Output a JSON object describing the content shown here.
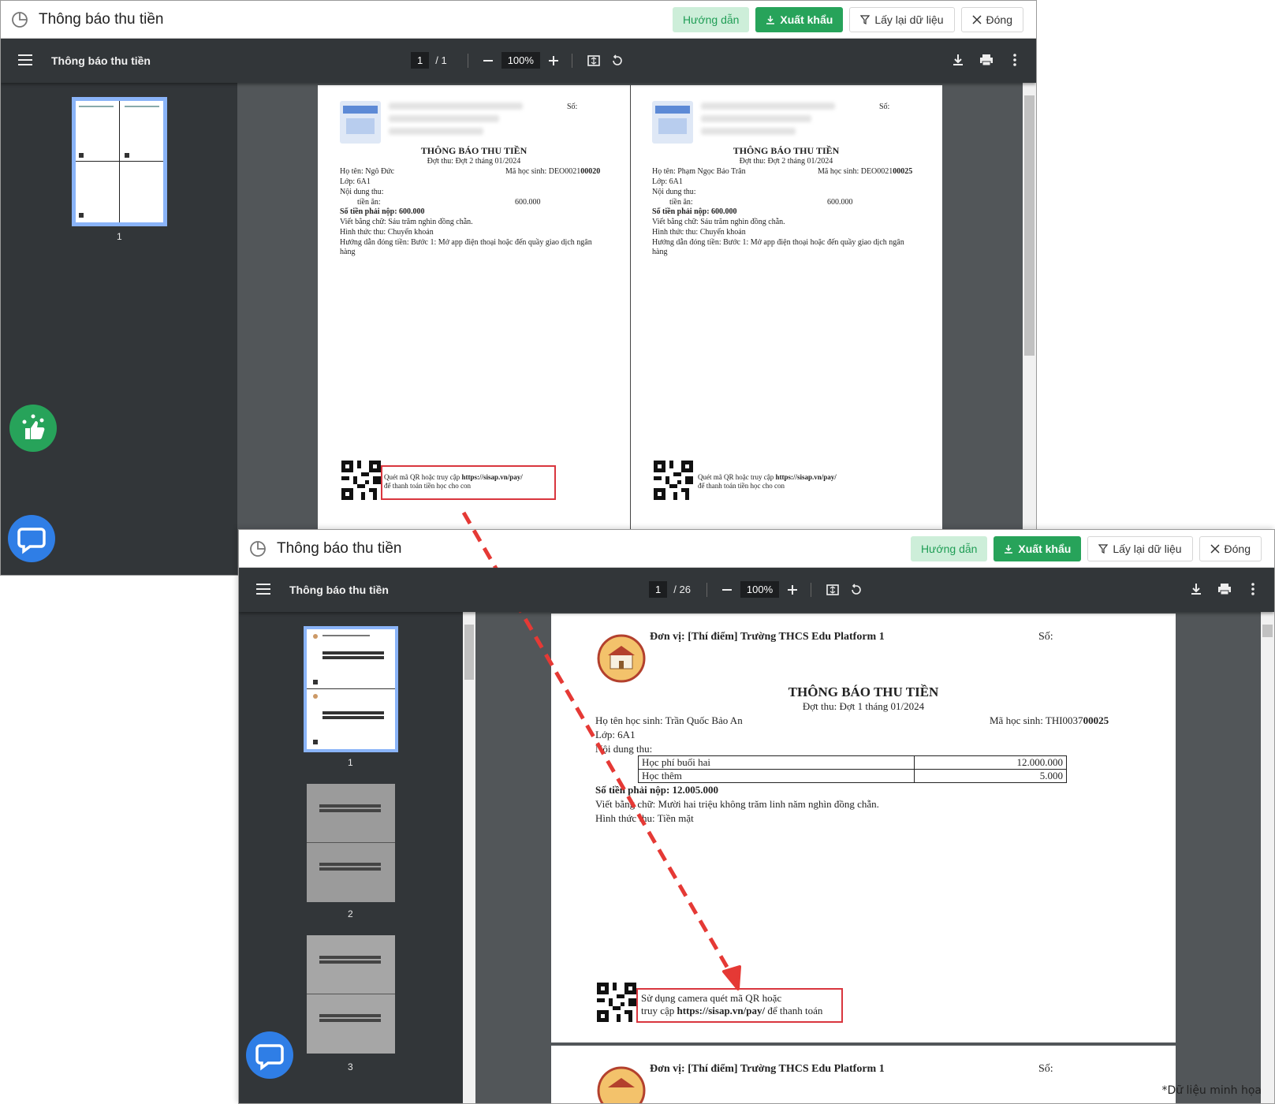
{
  "window1": {
    "title": "Thông báo thu tiền",
    "buttons": {
      "guide": "Hướng dẫn",
      "export": "Xuất khẩu",
      "reload": "Lấy lại dữ liệu",
      "close": "Đóng"
    },
    "pdf_toolbar": {
      "title": "Thông báo thu tiền",
      "current_page": "1",
      "total_pages": "/ 1",
      "zoom": "100%"
    },
    "thumbnail_label": "1",
    "receipts": [
      {
        "so_label": "Số:",
        "heading": "THÔNG BÁO THU TIỀN",
        "period": "Đợt thu: Đợt 2 tháng 01/2024",
        "name": "Họ tên: Ngô Đức",
        "code_prefix": "Mã học sinh: DEO0021",
        "code_suffix": "00020",
        "class": "Lớp: 6A1",
        "content_label": "Nội dung thu:",
        "item_label": "tiền ăn:",
        "item_value": "600.000",
        "amount_label": "Số tiền phải nộp: 600.000",
        "in_words": "Viết bằng chữ: Sáu trăm nghìn đồng chẵn.",
        "method": "Hình thức thu: Chuyển khoản",
        "guide_line1": "Hướng dẫn đóng tiền: Bước 1: Mở app điện thoại hoặc đến quầy giao dịch ngân",
        "guide_line2": "hàng",
        "qr_line1_prefix": "Quét mã QR hoặc truy cập ",
        "qr_link": "https://sisap.vn/pay/",
        "qr_line2": "để thanh toán tiền học cho con"
      },
      {
        "so_label": "Số:",
        "heading": "THÔNG BÁO THU TIỀN",
        "period": "Đợt thu: Đợt 2 tháng 01/2024",
        "name": "Họ tên: Phạm Ngọc Bảo Trân",
        "code_prefix": "Mã học sinh: DEO0021",
        "code_suffix": "00025",
        "class": "Lớp: 6A1",
        "content_label": "Nội dung thu:",
        "item_label": "tiền ăn:",
        "item_value": "600.000",
        "amount_label": "Số tiền phải nộp: 600.000",
        "in_words": "Viết bằng chữ: Sáu trăm nghìn đồng chẵn.",
        "method": "Hình thức thu: Chuyển khoản",
        "guide_line1": "Hướng dẫn đóng tiền: Bước 1: Mở app điện thoại hoặc đến quầy giao dịch ngân",
        "guide_line2": "hàng",
        "qr_line1_prefix": "Quét mã QR hoặc truy cập ",
        "qr_link": "https://sisap.vn/pay/",
        "qr_line2": "để thanh toán tiền học cho con"
      }
    ]
  },
  "window2": {
    "title": "Thông báo thu tiền",
    "buttons": {
      "guide": "Hướng dẫn",
      "export": "Xuất khẩu",
      "reload": "Lấy lại dữ liệu",
      "close": "Đóng"
    },
    "pdf_toolbar": {
      "title": "Thông báo thu tiền",
      "current_page": "1",
      "total_pages": "/ 26",
      "zoom": "100%"
    },
    "thumbnail_labels": [
      "1",
      "2",
      "3"
    ],
    "receipt": {
      "unit": "Đơn vị: [Thí điểm] Trường THCS Edu Platform 1",
      "so_label": "Số:",
      "heading": "THÔNG BÁO THU TIỀN",
      "period": "Đợt thu: Đợt 1 tháng 01/2024",
      "name": "Họ tên học sinh: Trần Quốc Bảo An",
      "code_prefix": "Mã học sinh: THI0037",
      "code_suffix": "00025",
      "class": "Lớp: 6A1",
      "content_label": "Nội dung thu:",
      "items": [
        {
          "name": "Học phí buổi hai",
          "amount": "12.000.000"
        },
        {
          "name": "Học thêm",
          "amount": "5.000"
        }
      ],
      "amount_label": "Số tiền phải nộp: 12.005.000",
      "in_words": "Viết bằng chữ: Mười hai triệu không trăm linh năm nghìn đồng chẵn.",
      "method": "Hình thức thu: Tiền mặt",
      "qr_line1": "Sử dụng camera quét mã QR hoặc",
      "qr_line2_prefix": "truy cập ",
      "qr_link": "https://sisap.vn/pay/",
      "qr_line2_suffix": " để thanh toán"
    },
    "next_receipt": {
      "unit": "Đơn vị: [Thí điểm] Trường THCS Edu Platform 1",
      "so_label": "Số:"
    }
  },
  "footnote": "*Dữ liệu minh họa",
  "colors": {
    "accent_green": "#27a35a",
    "guide_bg": "#cdeed9",
    "highlight_red": "#d9363e",
    "pdf_toolbar": "#323639",
    "viewer_bg": "#525659",
    "chat_blue": "#2f7ee6",
    "rate_green": "#27a35a"
  }
}
